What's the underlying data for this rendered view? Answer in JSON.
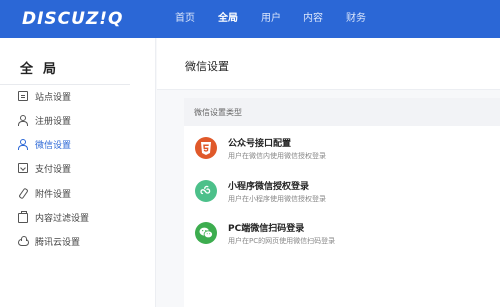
{
  "brand": {
    "logo_text": "DISCUZ!Q"
  },
  "nav": {
    "items": [
      {
        "label": "首页",
        "active": false
      },
      {
        "label": "全局",
        "active": true
      },
      {
        "label": "用户",
        "active": false
      },
      {
        "label": "内容",
        "active": false
      },
      {
        "label": "财务",
        "active": false
      }
    ]
  },
  "sidebar": {
    "title": "全局",
    "items": [
      {
        "label": "站点设置",
        "icon": "document-icon"
      },
      {
        "label": "注册设置",
        "icon": "user-icon"
      },
      {
        "label": "微信设置",
        "icon": "user-icon",
        "active": true
      },
      {
        "label": "支付设置",
        "icon": "payment-card-icon"
      },
      {
        "label": "附件设置",
        "icon": "paperclip-icon"
      },
      {
        "label": "内容过滤设置",
        "icon": "briefcase-icon"
      },
      {
        "label": "腾讯云设置",
        "icon": "cloud-icon"
      }
    ]
  },
  "page": {
    "title": "微信设置"
  },
  "settings": {
    "section_title": "微信设置类型",
    "options": [
      {
        "title": "公众号接口配置",
        "desc": "用户在微信内使用微信授权登录",
        "icon": "html5-icon",
        "color": "#e0592a"
      },
      {
        "title": "小程序微信授权登录",
        "desc": "用户在小程序使用微信授权登录",
        "icon": "mini-program-icon",
        "color": "#4cc08a"
      },
      {
        "title": "PC端微信扫码登录",
        "desc": "用户在PC的网页使用微信扫码登录",
        "icon": "wechat-icon",
        "color": "#3dad4f"
      }
    ]
  },
  "colors": {
    "primary": "#2b67d6"
  }
}
